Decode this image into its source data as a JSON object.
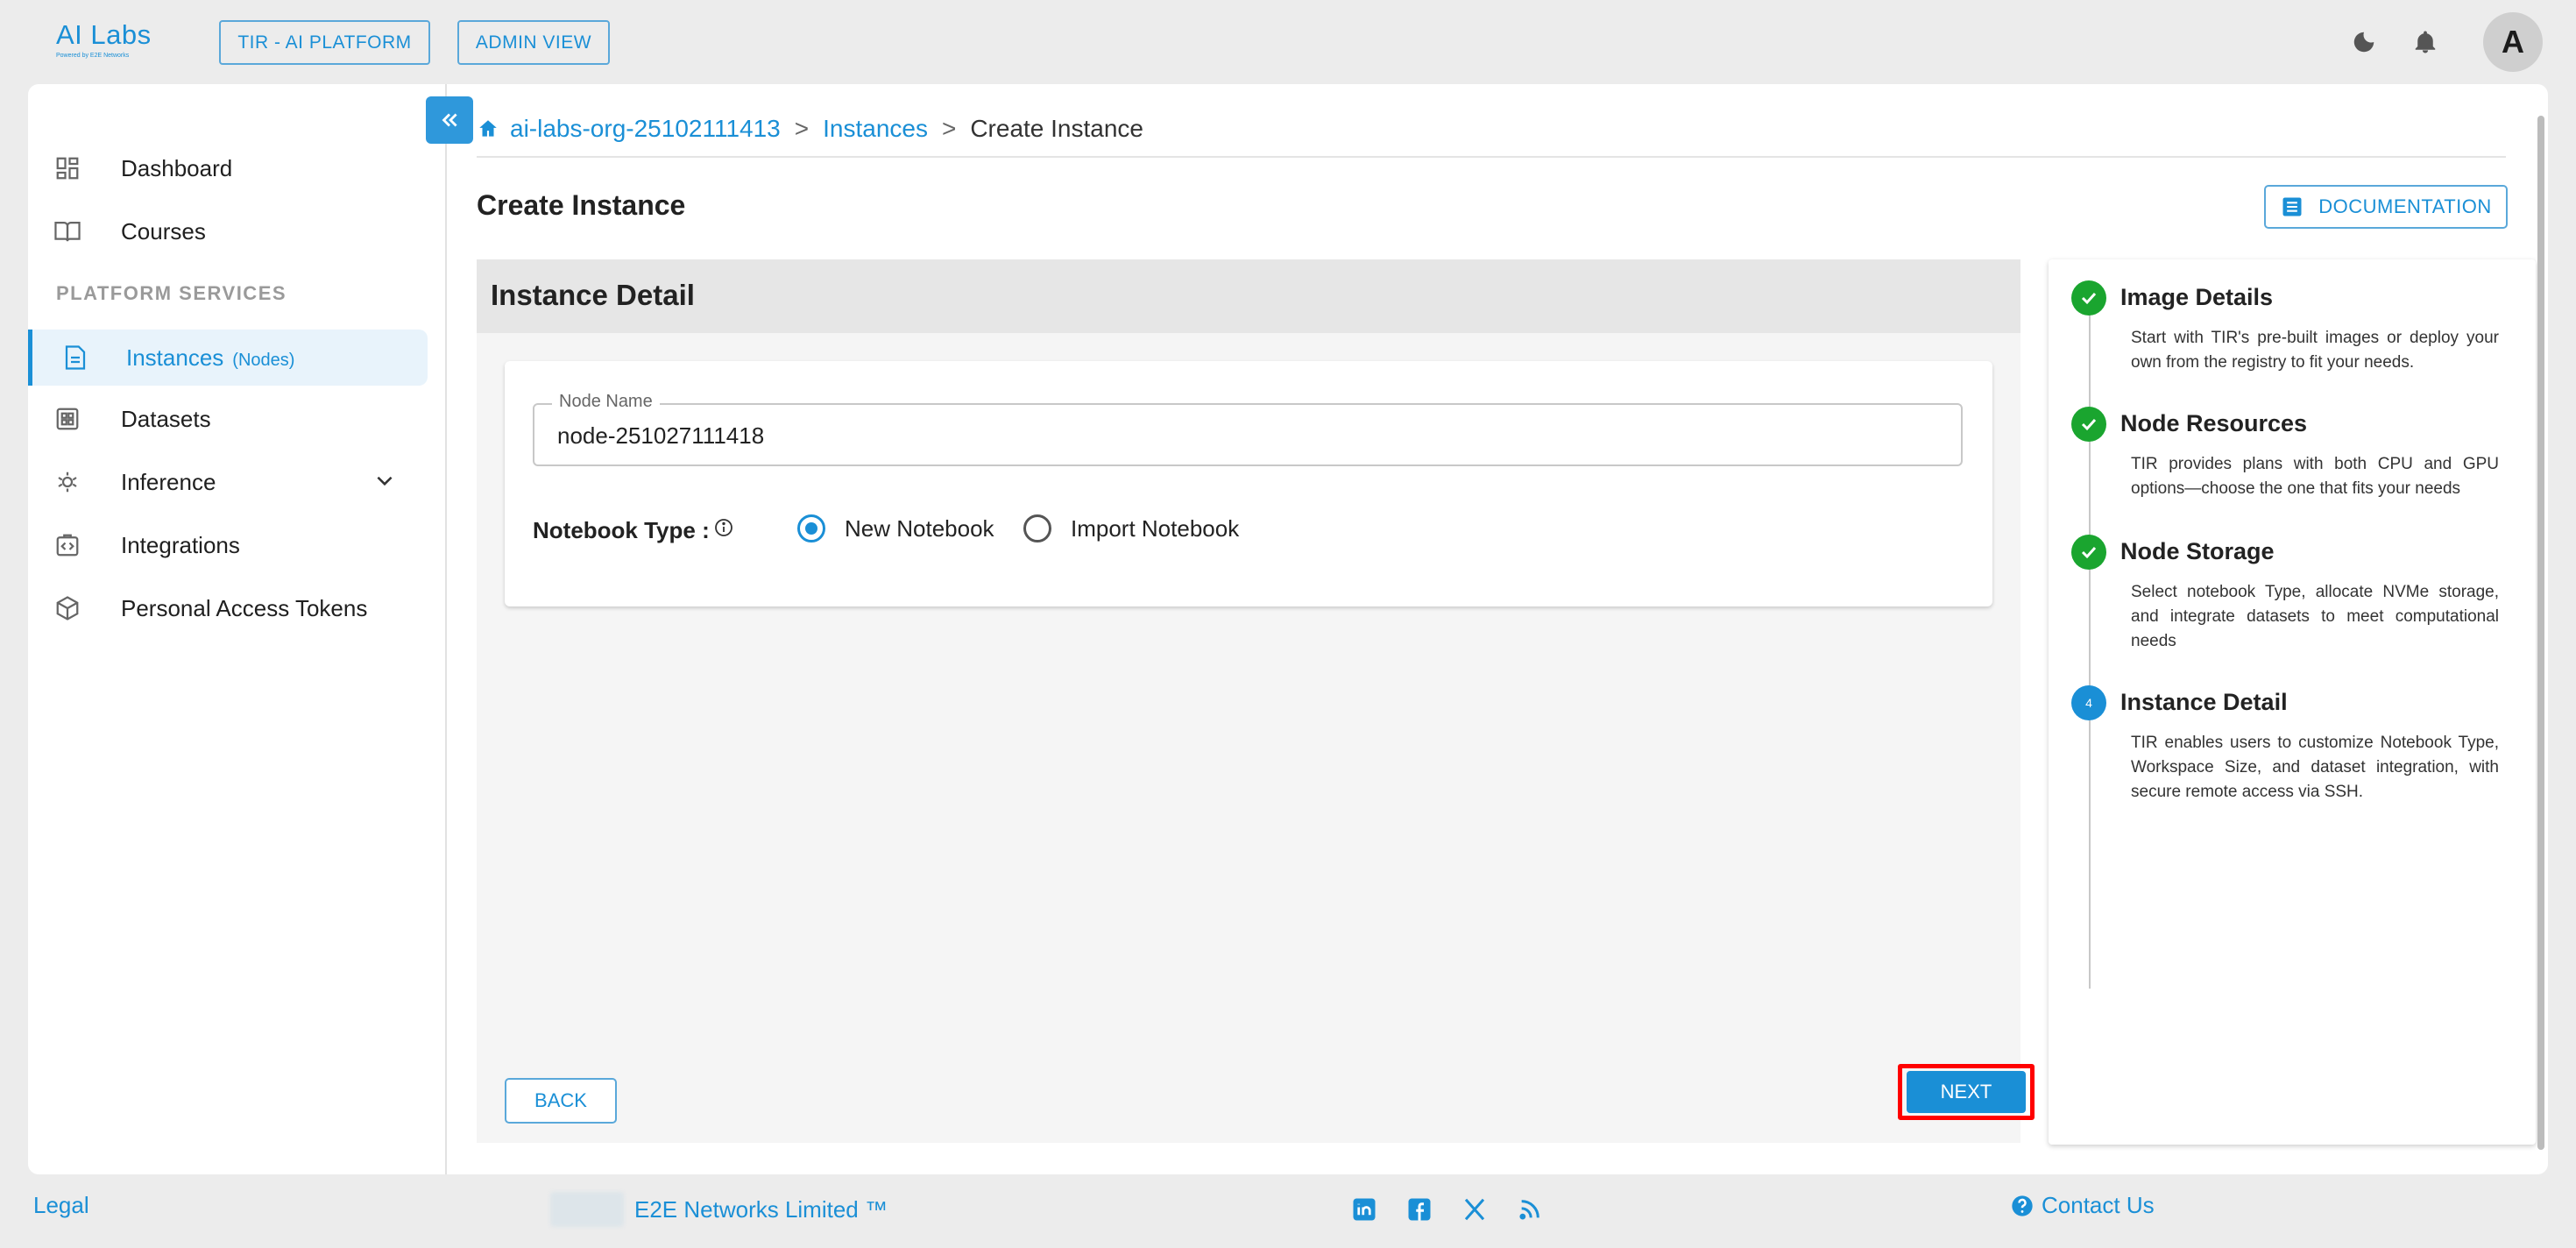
{
  "header": {
    "logo_text": "AI Labs",
    "logo_subtext": "Powered by E2E Networks",
    "platform_button": "TIR - AI PLATFORM",
    "admin_button": "ADMIN VIEW",
    "avatar_initial": "A"
  },
  "sidebar": {
    "section_label": "PLATFORM SERVICES",
    "items": [
      {
        "label": "Dashboard",
        "icon": "dashboard-icon"
      },
      {
        "label": "Courses",
        "icon": "book-icon"
      },
      {
        "label": "Instances",
        "sub": "(Nodes)",
        "icon": "document-icon",
        "active": true
      },
      {
        "label": "Datasets",
        "icon": "grid-icon"
      },
      {
        "label": "Inference",
        "icon": "inference-icon",
        "expandable": true
      },
      {
        "label": "Integrations",
        "icon": "integrations-icon"
      },
      {
        "label": "Personal Access Tokens",
        "icon": "cube-icon"
      }
    ]
  },
  "breadcrumb": {
    "org": "ai-labs-org-25102111413",
    "instances": "Instances",
    "current": "Create Instance",
    "separator": ">"
  },
  "page": {
    "title": "Create Instance",
    "documentation_button": "DOCUMENTATION"
  },
  "form": {
    "section_title": "Instance Detail",
    "node_name_label": "Node Name",
    "node_name_value": "node-251027111418",
    "notebook_type_label": "Notebook Type :",
    "radio_options": [
      {
        "label": "New Notebook",
        "selected": true
      },
      {
        "label": "Import Notebook",
        "selected": false
      }
    ],
    "back_button": "BACK",
    "next_button": "NEXT"
  },
  "stepper": {
    "steps": [
      {
        "title": "Image Details",
        "desc": "Start with TIR's pre-built images or deploy your own from the registry to fit your needs.",
        "state": "done"
      },
      {
        "title": "Node Resources",
        "desc": "TIR provides plans with both CPU and GPU options—choose the one that fits your needs",
        "state": "done"
      },
      {
        "title": "Node Storage",
        "desc": "Select notebook Type, allocate NVMe storage, and integrate datasets to meet computational needs",
        "state": "done"
      },
      {
        "title": "Instance Detail",
        "desc": "TIR enables users to customize Notebook Type, Workspace Size, and dataset integration, with secure remote access via SSH.",
        "state": "current",
        "number": "4"
      }
    ]
  },
  "footer": {
    "legal": "Legal",
    "company": "E2E Networks Limited ™",
    "contact": "Contact Us",
    "social": [
      "linkedin-icon",
      "facebook-icon",
      "x-icon",
      "rss-icon"
    ]
  },
  "colors": {
    "accent": "#1a8fd6",
    "success": "#1aa52f",
    "highlight": "#ff0000"
  }
}
